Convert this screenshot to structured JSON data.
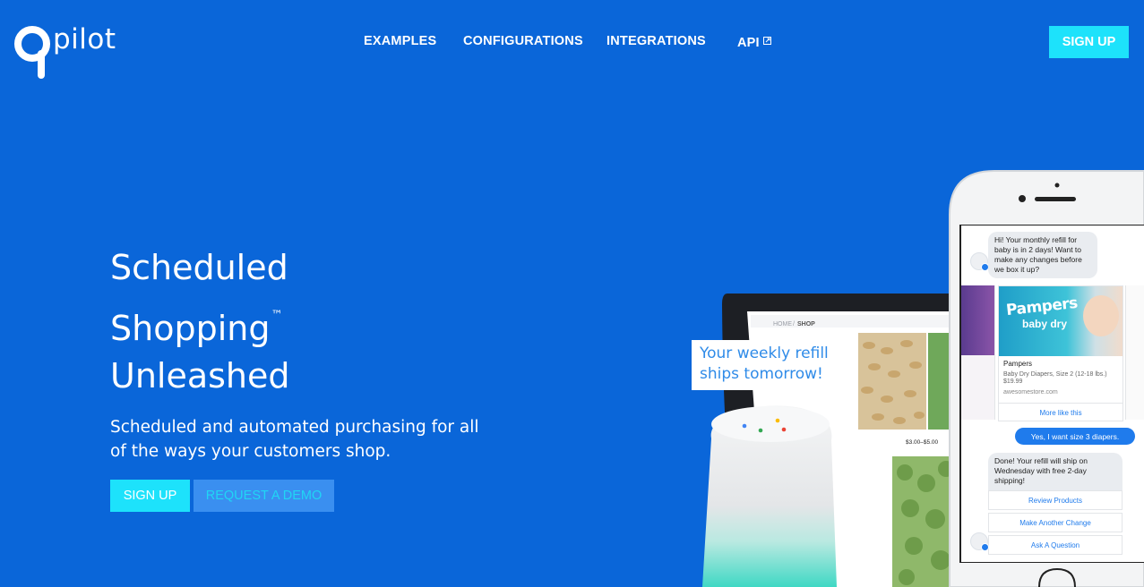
{
  "brand": {
    "name": "pilot"
  },
  "nav": {
    "items": [
      {
        "label": "EXAMPLES"
      },
      {
        "label": "CONFIGURATIONS"
      },
      {
        "label": "INTEGRATIONS"
      },
      {
        "label": "API"
      }
    ],
    "signup_label": "SIGN UP"
  },
  "hero": {
    "title_lines": [
      "Scheduled",
      "Shopping",
      "Unleashed"
    ],
    "trademark": "™",
    "subtitle": "Scheduled and automated purchasing for all of the ways your customers shop.",
    "signup_label": "SIGN UP",
    "demo_label": "REQUEST A DEMO"
  },
  "illustration": {
    "speaker_bubble": "Your weekly refill ships tomorrow!",
    "tablet": {
      "breadcrumb_home": "HOME",
      "breadcrumb_sep": "/",
      "breadcrumb_current": "SHOP",
      "price_range": "$3.00–$5.00"
    },
    "chat": {
      "bot_message_1": "Hi! Your monthly refill for baby is in 2 days! Want to make any changes before we box it up?",
      "product": {
        "brand": "Pampers",
        "variant": "baby dry",
        "name": "Pampers",
        "description": "Baby Dry Diapers, Size 2 (12-18 lbs.)",
        "price": "$19.99",
        "domain": "awesomestore.com",
        "link": "More like this"
      },
      "user_message": "Yes, I want size 3 diapers.",
      "bot_message_2": "Done! Your refill will ship on Wednesday with free 2-day shipping!",
      "quick_replies": [
        "Review Products",
        "Make Another Change",
        "Ask A Question"
      ]
    }
  },
  "colors": {
    "background": "#0a66d9",
    "accent": "#1de2fb",
    "demo_button": "#3a8ff0",
    "chat_blue": "#1f7bec"
  }
}
